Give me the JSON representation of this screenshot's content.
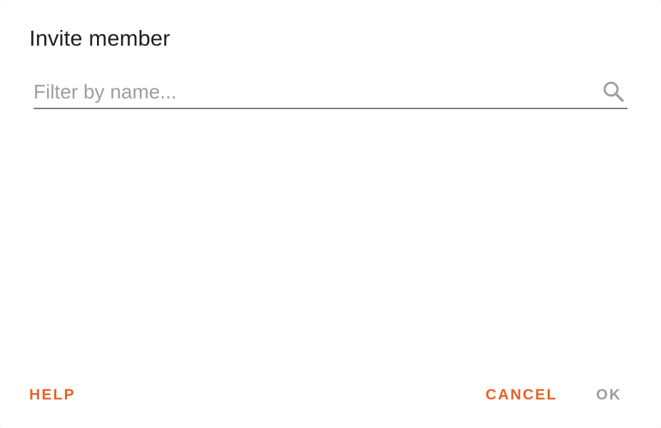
{
  "dialog": {
    "title": "Invite member",
    "search": {
      "placeholder": "Filter by name...",
      "value": ""
    },
    "buttons": {
      "help": "HELP",
      "cancel": "CANCEL",
      "ok": "OK"
    }
  },
  "colors": {
    "accent": "#e8612a",
    "disabled": "#9e9e9e",
    "title": "#212121",
    "underline": "#7a7a7a"
  },
  "icons": {
    "search": "search-icon"
  }
}
